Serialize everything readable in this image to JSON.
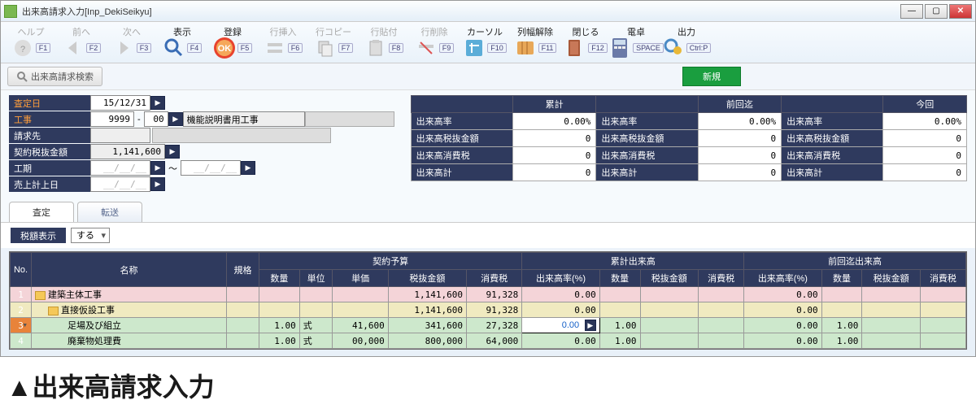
{
  "title": "出来高請求入力[Inp_DekiSeikyu]",
  "toolbar": {
    "help": {
      "label": "ヘルプ",
      "fkey": "F1"
    },
    "prev": {
      "label": "前へ",
      "fkey": "F2"
    },
    "next": {
      "label": "次へ",
      "fkey": "F3"
    },
    "show": {
      "label": "表示",
      "fkey": "F4"
    },
    "reg": {
      "label": "登録",
      "fkey": "F5"
    },
    "ins": {
      "label": "行挿入",
      "fkey": "F6"
    },
    "copy": {
      "label": "行コピー",
      "fkey": "F7"
    },
    "paste": {
      "label": "行貼付",
      "fkey": "F8"
    },
    "del": {
      "label": "行削除",
      "fkey": "F9"
    },
    "cursor": {
      "label": "カーソル",
      "fkey": "F10"
    },
    "colw": {
      "label": "列幅解除",
      "fkey": "F11"
    },
    "close": {
      "label": "閉じる",
      "fkey": "F12"
    },
    "calc": {
      "label": "電卓",
      "fkey": "SPACE"
    },
    "out": {
      "label": "出力",
      "fkey": "Ctrl:P"
    }
  },
  "search_btn": "出来高請求検索",
  "new_btn": "新規",
  "form": {
    "satei_lbl": "査定日",
    "satei_val": "15/12/31",
    "koji_lbl": "工事",
    "koji_code": "9999",
    "koji_sub": "00",
    "koji_name": "機能説明書用工事",
    "seikyu_lbl": "請求先",
    "keiyaku_lbl": "契約税抜金額",
    "keiyaku_val": "1,141,600",
    "kouki_lbl": "工期",
    "kouki_sep": "～",
    "date_ph": "__/__/__",
    "uriage_lbl": "売上計上日"
  },
  "summary": {
    "h1": "累計",
    "h2": "前回迄",
    "h3": "今回",
    "r1": "出来高率",
    "r2": "出来高税抜金額",
    "r3": "出来高消費税",
    "r4": "出来高計",
    "pct": "0.00%",
    "zero": "0"
  },
  "tabs": {
    "t1": "査定",
    "t2": "転送"
  },
  "opt": {
    "lbl": "税額表示",
    "val": "する"
  },
  "grid": {
    "h_no": "No.",
    "h_name": "名称",
    "h_spec": "規格",
    "g_keiyaku": "契約予算",
    "g_ruikei": "累計出来高",
    "g_zenkai": "前回迄出来高",
    "h_qty": "数量",
    "h_unit": "単位",
    "h_price": "単価",
    "h_amt": "税抜金額",
    "h_tax": "消費税",
    "h_rate": "出来高率(%)",
    "rows": [
      {
        "no": "1",
        "name": "建築主体工事",
        "amt": "1,141,600",
        "tax": "91,328",
        "rate": "0.00",
        "zrate": "0.00"
      },
      {
        "no": "2",
        "name": "直接仮設工事",
        "amt": "1,141,600",
        "tax": "91,328",
        "rate": "0.00",
        "zrate": "0.00"
      },
      {
        "no": "3",
        "name": "足場及び組立",
        "qty": "1.00",
        "unit": "式",
        "price": "41,600",
        "amt": "341,600",
        "tax": "27,328",
        "rate": "0.00",
        "rqty": "1.00",
        "zrate": "0.00",
        "zqty": "1.00"
      },
      {
        "no": "4",
        "name": "廃棄物処理費",
        "qty": "1.00",
        "unit": "式",
        "price": "00,000",
        "amt": "800,000",
        "tax": "64,000",
        "rate": "0.00",
        "rqty": "1.00",
        "zrate": "0.00",
        "zqty": "1.00"
      }
    ]
  },
  "caption": "▲出来高請求入力"
}
